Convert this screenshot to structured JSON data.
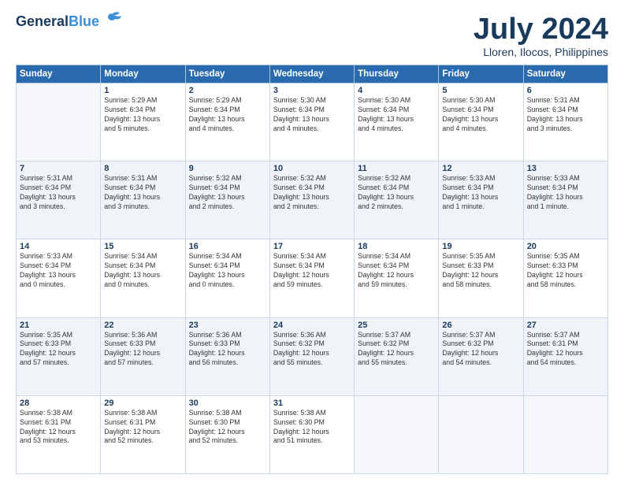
{
  "logo": {
    "line1": "General",
    "line2": "Blue"
  },
  "title": "July 2024",
  "location": "Lloren, Ilocos, Philippines",
  "weekdays": [
    "Sunday",
    "Monday",
    "Tuesday",
    "Wednesday",
    "Thursday",
    "Friday",
    "Saturday"
  ],
  "weeks": [
    [
      {
        "day": "",
        "info": ""
      },
      {
        "day": "1",
        "info": "Sunrise: 5:29 AM\nSunset: 6:34 PM\nDaylight: 13 hours\nand 5 minutes."
      },
      {
        "day": "2",
        "info": "Sunrise: 5:29 AM\nSunset: 6:34 PM\nDaylight: 13 hours\nand 4 minutes."
      },
      {
        "day": "3",
        "info": "Sunrise: 5:30 AM\nSunset: 6:34 PM\nDaylight: 13 hours\nand 4 minutes."
      },
      {
        "day": "4",
        "info": "Sunrise: 5:30 AM\nSunset: 6:34 PM\nDaylight: 13 hours\nand 4 minutes."
      },
      {
        "day": "5",
        "info": "Sunrise: 5:30 AM\nSunset: 6:34 PM\nDaylight: 13 hours\nand 4 minutes."
      },
      {
        "day": "6",
        "info": "Sunrise: 5:31 AM\nSunset: 6:34 PM\nDaylight: 13 hours\nand 3 minutes."
      }
    ],
    [
      {
        "day": "7",
        "info": "Sunrise: 5:31 AM\nSunset: 6:34 PM\nDaylight: 13 hours\nand 3 minutes."
      },
      {
        "day": "8",
        "info": "Sunrise: 5:31 AM\nSunset: 6:34 PM\nDaylight: 13 hours\nand 3 minutes."
      },
      {
        "day": "9",
        "info": "Sunrise: 5:32 AM\nSunset: 6:34 PM\nDaylight: 13 hours\nand 2 minutes."
      },
      {
        "day": "10",
        "info": "Sunrise: 5:32 AM\nSunset: 6:34 PM\nDaylight: 13 hours\nand 2 minutes."
      },
      {
        "day": "11",
        "info": "Sunrise: 5:32 AM\nSunset: 6:34 PM\nDaylight: 13 hours\nand 2 minutes."
      },
      {
        "day": "12",
        "info": "Sunrise: 5:33 AM\nSunset: 6:34 PM\nDaylight: 13 hours\nand 1 minute."
      },
      {
        "day": "13",
        "info": "Sunrise: 5:33 AM\nSunset: 6:34 PM\nDaylight: 13 hours\nand 1 minute."
      }
    ],
    [
      {
        "day": "14",
        "info": "Sunrise: 5:33 AM\nSunset: 6:34 PM\nDaylight: 13 hours\nand 0 minutes."
      },
      {
        "day": "15",
        "info": "Sunrise: 5:34 AM\nSunset: 6:34 PM\nDaylight: 13 hours\nand 0 minutes."
      },
      {
        "day": "16",
        "info": "Sunrise: 5:34 AM\nSunset: 6:34 PM\nDaylight: 13 hours\nand 0 minutes."
      },
      {
        "day": "17",
        "info": "Sunrise: 5:34 AM\nSunset: 6:34 PM\nDaylight: 12 hours\nand 59 minutes."
      },
      {
        "day": "18",
        "info": "Sunrise: 5:34 AM\nSunset: 6:34 PM\nDaylight: 12 hours\nand 59 minutes."
      },
      {
        "day": "19",
        "info": "Sunrise: 5:35 AM\nSunset: 6:33 PM\nDaylight: 12 hours\nand 58 minutes."
      },
      {
        "day": "20",
        "info": "Sunrise: 5:35 AM\nSunset: 6:33 PM\nDaylight: 12 hours\nand 58 minutes."
      }
    ],
    [
      {
        "day": "21",
        "info": "Sunrise: 5:35 AM\nSunset: 6:33 PM\nDaylight: 12 hours\nand 57 minutes."
      },
      {
        "day": "22",
        "info": "Sunrise: 5:36 AM\nSunset: 6:33 PM\nDaylight: 12 hours\nand 57 minutes."
      },
      {
        "day": "23",
        "info": "Sunrise: 5:36 AM\nSunset: 6:33 PM\nDaylight: 12 hours\nand 56 minutes."
      },
      {
        "day": "24",
        "info": "Sunrise: 5:36 AM\nSunset: 6:32 PM\nDaylight: 12 hours\nand 55 minutes."
      },
      {
        "day": "25",
        "info": "Sunrise: 5:37 AM\nSunset: 6:32 PM\nDaylight: 12 hours\nand 55 minutes."
      },
      {
        "day": "26",
        "info": "Sunrise: 5:37 AM\nSunset: 6:32 PM\nDaylight: 12 hours\nand 54 minutes."
      },
      {
        "day": "27",
        "info": "Sunrise: 5:37 AM\nSunset: 6:31 PM\nDaylight: 12 hours\nand 54 minutes."
      }
    ],
    [
      {
        "day": "28",
        "info": "Sunrise: 5:38 AM\nSunset: 6:31 PM\nDaylight: 12 hours\nand 53 minutes."
      },
      {
        "day": "29",
        "info": "Sunrise: 5:38 AM\nSunset: 6:31 PM\nDaylight: 12 hours\nand 52 minutes."
      },
      {
        "day": "30",
        "info": "Sunrise: 5:38 AM\nSunset: 6:30 PM\nDaylight: 12 hours\nand 52 minutes."
      },
      {
        "day": "31",
        "info": "Sunrise: 5:38 AM\nSunset: 6:30 PM\nDaylight: 12 hours\nand 51 minutes."
      },
      {
        "day": "",
        "info": ""
      },
      {
        "day": "",
        "info": ""
      },
      {
        "day": "",
        "info": ""
      }
    ]
  ]
}
